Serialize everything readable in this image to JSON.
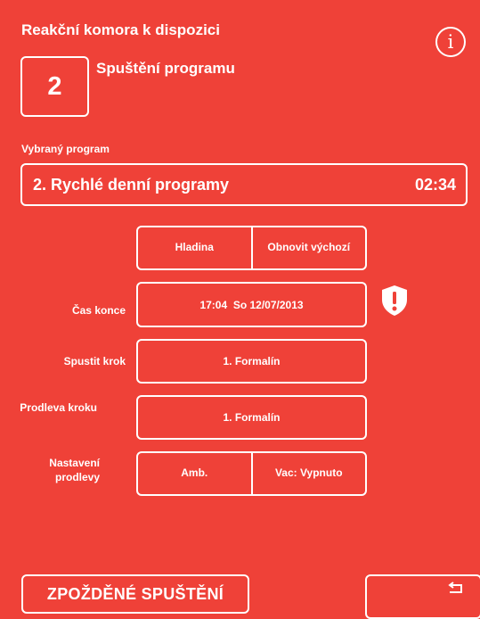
{
  "header": {
    "title": "Reakční komora k dispozici",
    "chamber_number": "2",
    "subtitle": "Spuštění programu",
    "info_icon": "info-icon"
  },
  "selected_program": {
    "label": "Vybraný program",
    "name": "2. Rychlé denní programy",
    "duration": "02:34"
  },
  "options": {
    "level_label": "Hladina",
    "restore_default_label": "Obnovit výchozí"
  },
  "end_time": {
    "label": "Čas konce",
    "value": "17:04  So 12/07/2013",
    "warning_icon": "shield-warning-icon"
  },
  "start_step": {
    "label": "Spustit krok",
    "value": "1. Formalín"
  },
  "step_delay": {
    "label": "Prodleva kroku",
    "value": "1. Formalín"
  },
  "delay_settings": {
    "label": "Nastavení prodlevy",
    "amb_value": "Amb.",
    "vac_value": "Vac: Vypnuto"
  },
  "footer": {
    "delayed_start_label": "ZPOŽDĚNÉ SPUŠTĚNÍ",
    "back_icon": "return-icon"
  },
  "colors": {
    "background": "#ef4138",
    "foreground": "#ffffff"
  }
}
